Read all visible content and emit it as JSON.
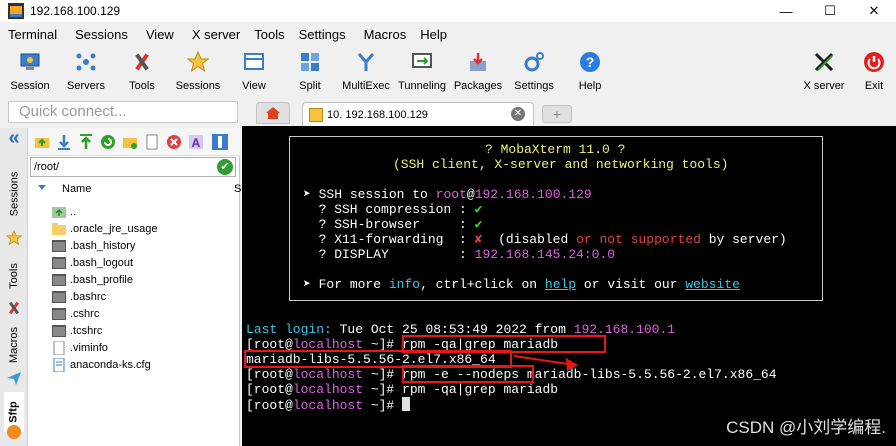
{
  "window": {
    "title": "192.168.100.129",
    "min": "—",
    "max": "☐",
    "close": "✕"
  },
  "menu": [
    "Terminal",
    "Sessions",
    "View",
    "X server",
    "Tools",
    "Settings",
    "Macros",
    "Help"
  ],
  "toolbar": {
    "session": "Session",
    "servers": "Servers",
    "tools": "Tools",
    "sessions": "Sessions",
    "view": "View",
    "split": "Split",
    "multiexec": "MultiExec",
    "tunneling": "Tunneling",
    "packages": "Packages",
    "settings": "Settings",
    "help": "Help",
    "xserver": "X server",
    "exit": "Exit"
  },
  "quick_connect": {
    "placeholder": "Quick connect..."
  },
  "side_tabs": {
    "sessions": "Sessions",
    "tools": "Tools",
    "macros": "Macros",
    "sftp": "Sftp"
  },
  "file_panel": {
    "path": "/root/",
    "col_name": "Name",
    "col_size": "S",
    "files": [
      "..",
      ".oracle_jre_usage",
      ".bash_history",
      ".bash_logout",
      ".bash_profile",
      ".bashrc",
      ".cshrc",
      ".tcshrc",
      ".viminfo",
      "anaconda-ks.cfg"
    ]
  },
  "tabs": {
    "session_tab": "10. 192.168.100.129",
    "close": "✕",
    "new": "+"
  },
  "terminal": {
    "banner_title": "? MobaXterm 11.0 ?",
    "banner_sub": "(SSH client, X-server and networking tools)",
    "ssh_session_label": "➤ SSH session to",
    "ssh_user": "root",
    "ssh_at": "@",
    "ssh_host": "192.168.100.129",
    "compression_label": "  ? SSH compression : ",
    "compression_val": "✔",
    "browser_label": "  ? SSH-browser     : ",
    "browser_val": "✔",
    "x11_label": "  ? X11-forwarding  : ",
    "x11_val": "✘",
    "x11_note_1": "  (disabled ",
    "x11_note_or": "or",
    "x11_note_not": " not supported",
    "x11_note_2": " by server)",
    "display_label": "  ? DISPLAY         : ",
    "display_val": "192.168.145.24:0.0",
    "more_1": "➤ For more ",
    "more_info": "info",
    "more_2": ", ctrl+click on ",
    "more_help": "help",
    "more_3": " or visit our ",
    "more_site": "website",
    "last_login_label": "Last login:",
    "last_login_date": " Tue Oct 25 08:53:49 2022 from ",
    "last_login_host": "192.168.100.1",
    "prompt_open": "[root@",
    "prompt_host": "localhost",
    "prompt_close": " ~]# ",
    "cmd1": "rpm -qa|grep mariadb",
    "out1": "mariadb-libs-5.5.56-2.el7.x86_64",
    "cmd2a": "rpm -e --nodeps",
    "cmd2b": " mariadb-libs-5.5.56-2.el7.x86_64",
    "cmd3": "rpm -qa|grep mariadb",
    "prompt4": " ~]# "
  },
  "watermark": "CSDN @小刘学编程.",
  "colors": {
    "annotation_red": "#e81818",
    "prompt_magenta": "#e060e0",
    "banner_yellow": "#f0f078"
  }
}
